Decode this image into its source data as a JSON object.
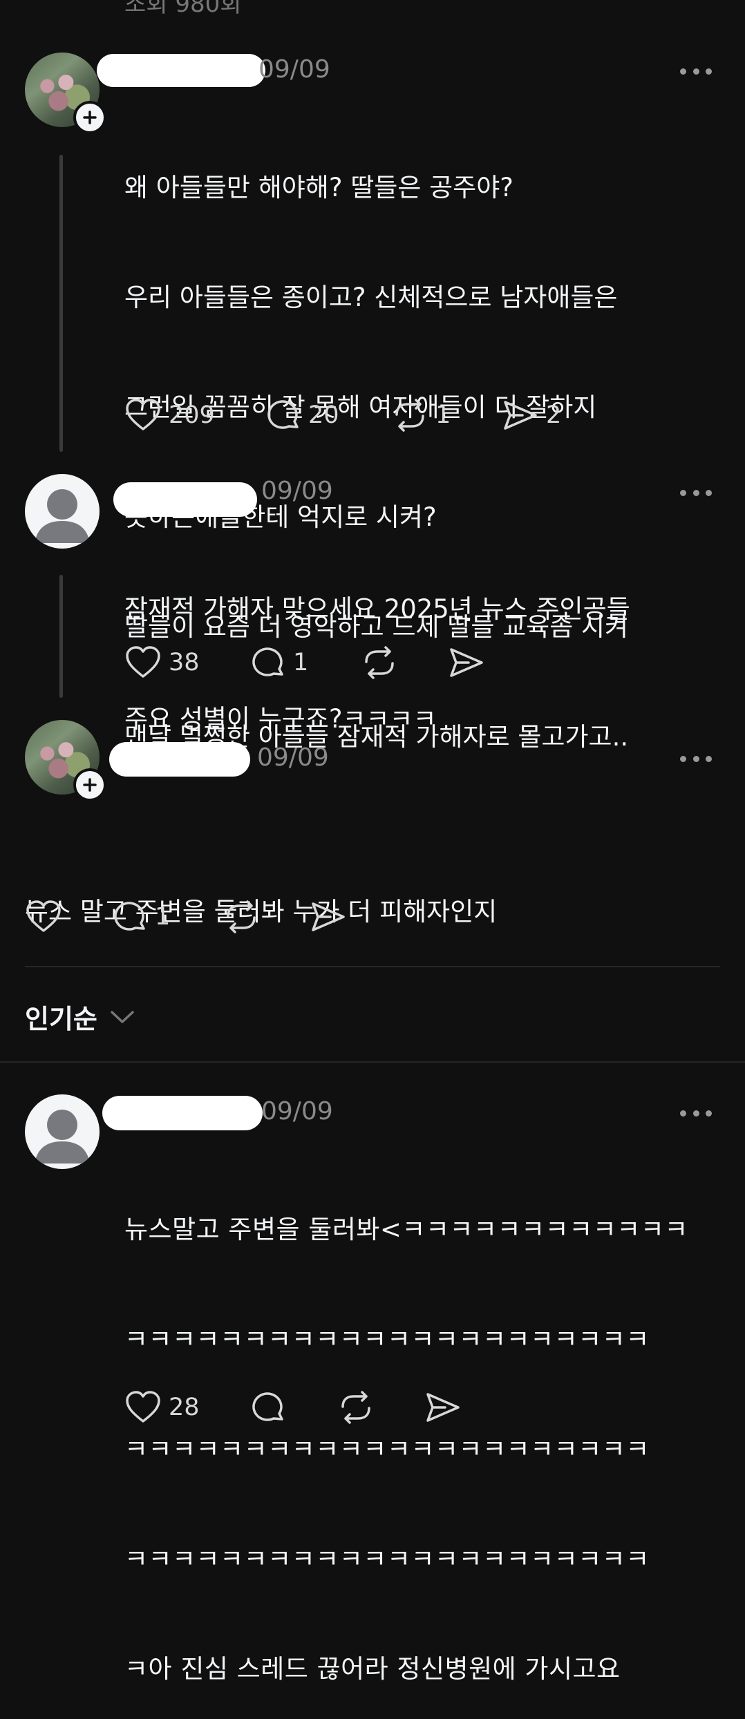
{
  "top": {
    "partial_text": "조회 980회"
  },
  "comments": [
    {
      "date": "09/09",
      "lines": [
        "왜 아들들만 해야해? 딸들은 공주야?",
        "우리 아들들은 종이고? 신체적으로 남자애들은",
        "그런일 꼼꼼히 잘 못해 여자애들이 더 잘하지",
        "못하는애들한테 억지로 시켜?",
        "딸들이 요즘 더 영악하고 드세 딸들 교육좀 시켜",
        "맨날 멀쩡한 아들들 잠재적 가해자로 몰고가고.."
      ],
      "likes": "209",
      "replies": "20",
      "reposts": "1",
      "shares": "2"
    },
    {
      "date": "09/09",
      "lines": [
        "잠재적 가해자 맞으세요 2025년 뉴스 주인공들",
        "주요 성별이 누구죠?ㅋㅋㅋㅋ"
      ],
      "likes": "38",
      "replies": "1"
    },
    {
      "date": "09/09",
      "lines": [
        "뉴스 말고 주변을 둘러봐 누가 더 피해자인지"
      ],
      "replies": "1"
    },
    {
      "date": "09/09",
      "lines": [
        "뉴스말고 주변을 둘러봐<ㅋㅋㅋㅋㅋㅋㅋㅋㅋㅋㅋㅋ",
        "ㅋㅋㅋㅋㅋㅋㅋㅋㅋㅋㅋㅋㅋㅋㅋㅋㅋㅋㅋㅋㅋㅋ",
        "ㅋㅋㅋㅋㅋㅋㅋㅋㅋㅋㅋㅋㅋㅋㅋㅋㅋㅋㅋㅋㅋㅋ",
        "ㅋㅋㅋㅋㅋㅋㅋㅋㅋㅋㅋㅋㅋㅋㅋㅋㅋㅋㅋㅋㅋㅋ",
        "ㅋ아 진심 스레드 끊어라 정신병원에 가시고요"
      ],
      "likes": "28"
    }
  ],
  "sort": {
    "label": "인기순"
  },
  "colors": {
    "background": "#101010",
    "text": "#f3f5f7",
    "muted": "#8a8a8a"
  }
}
